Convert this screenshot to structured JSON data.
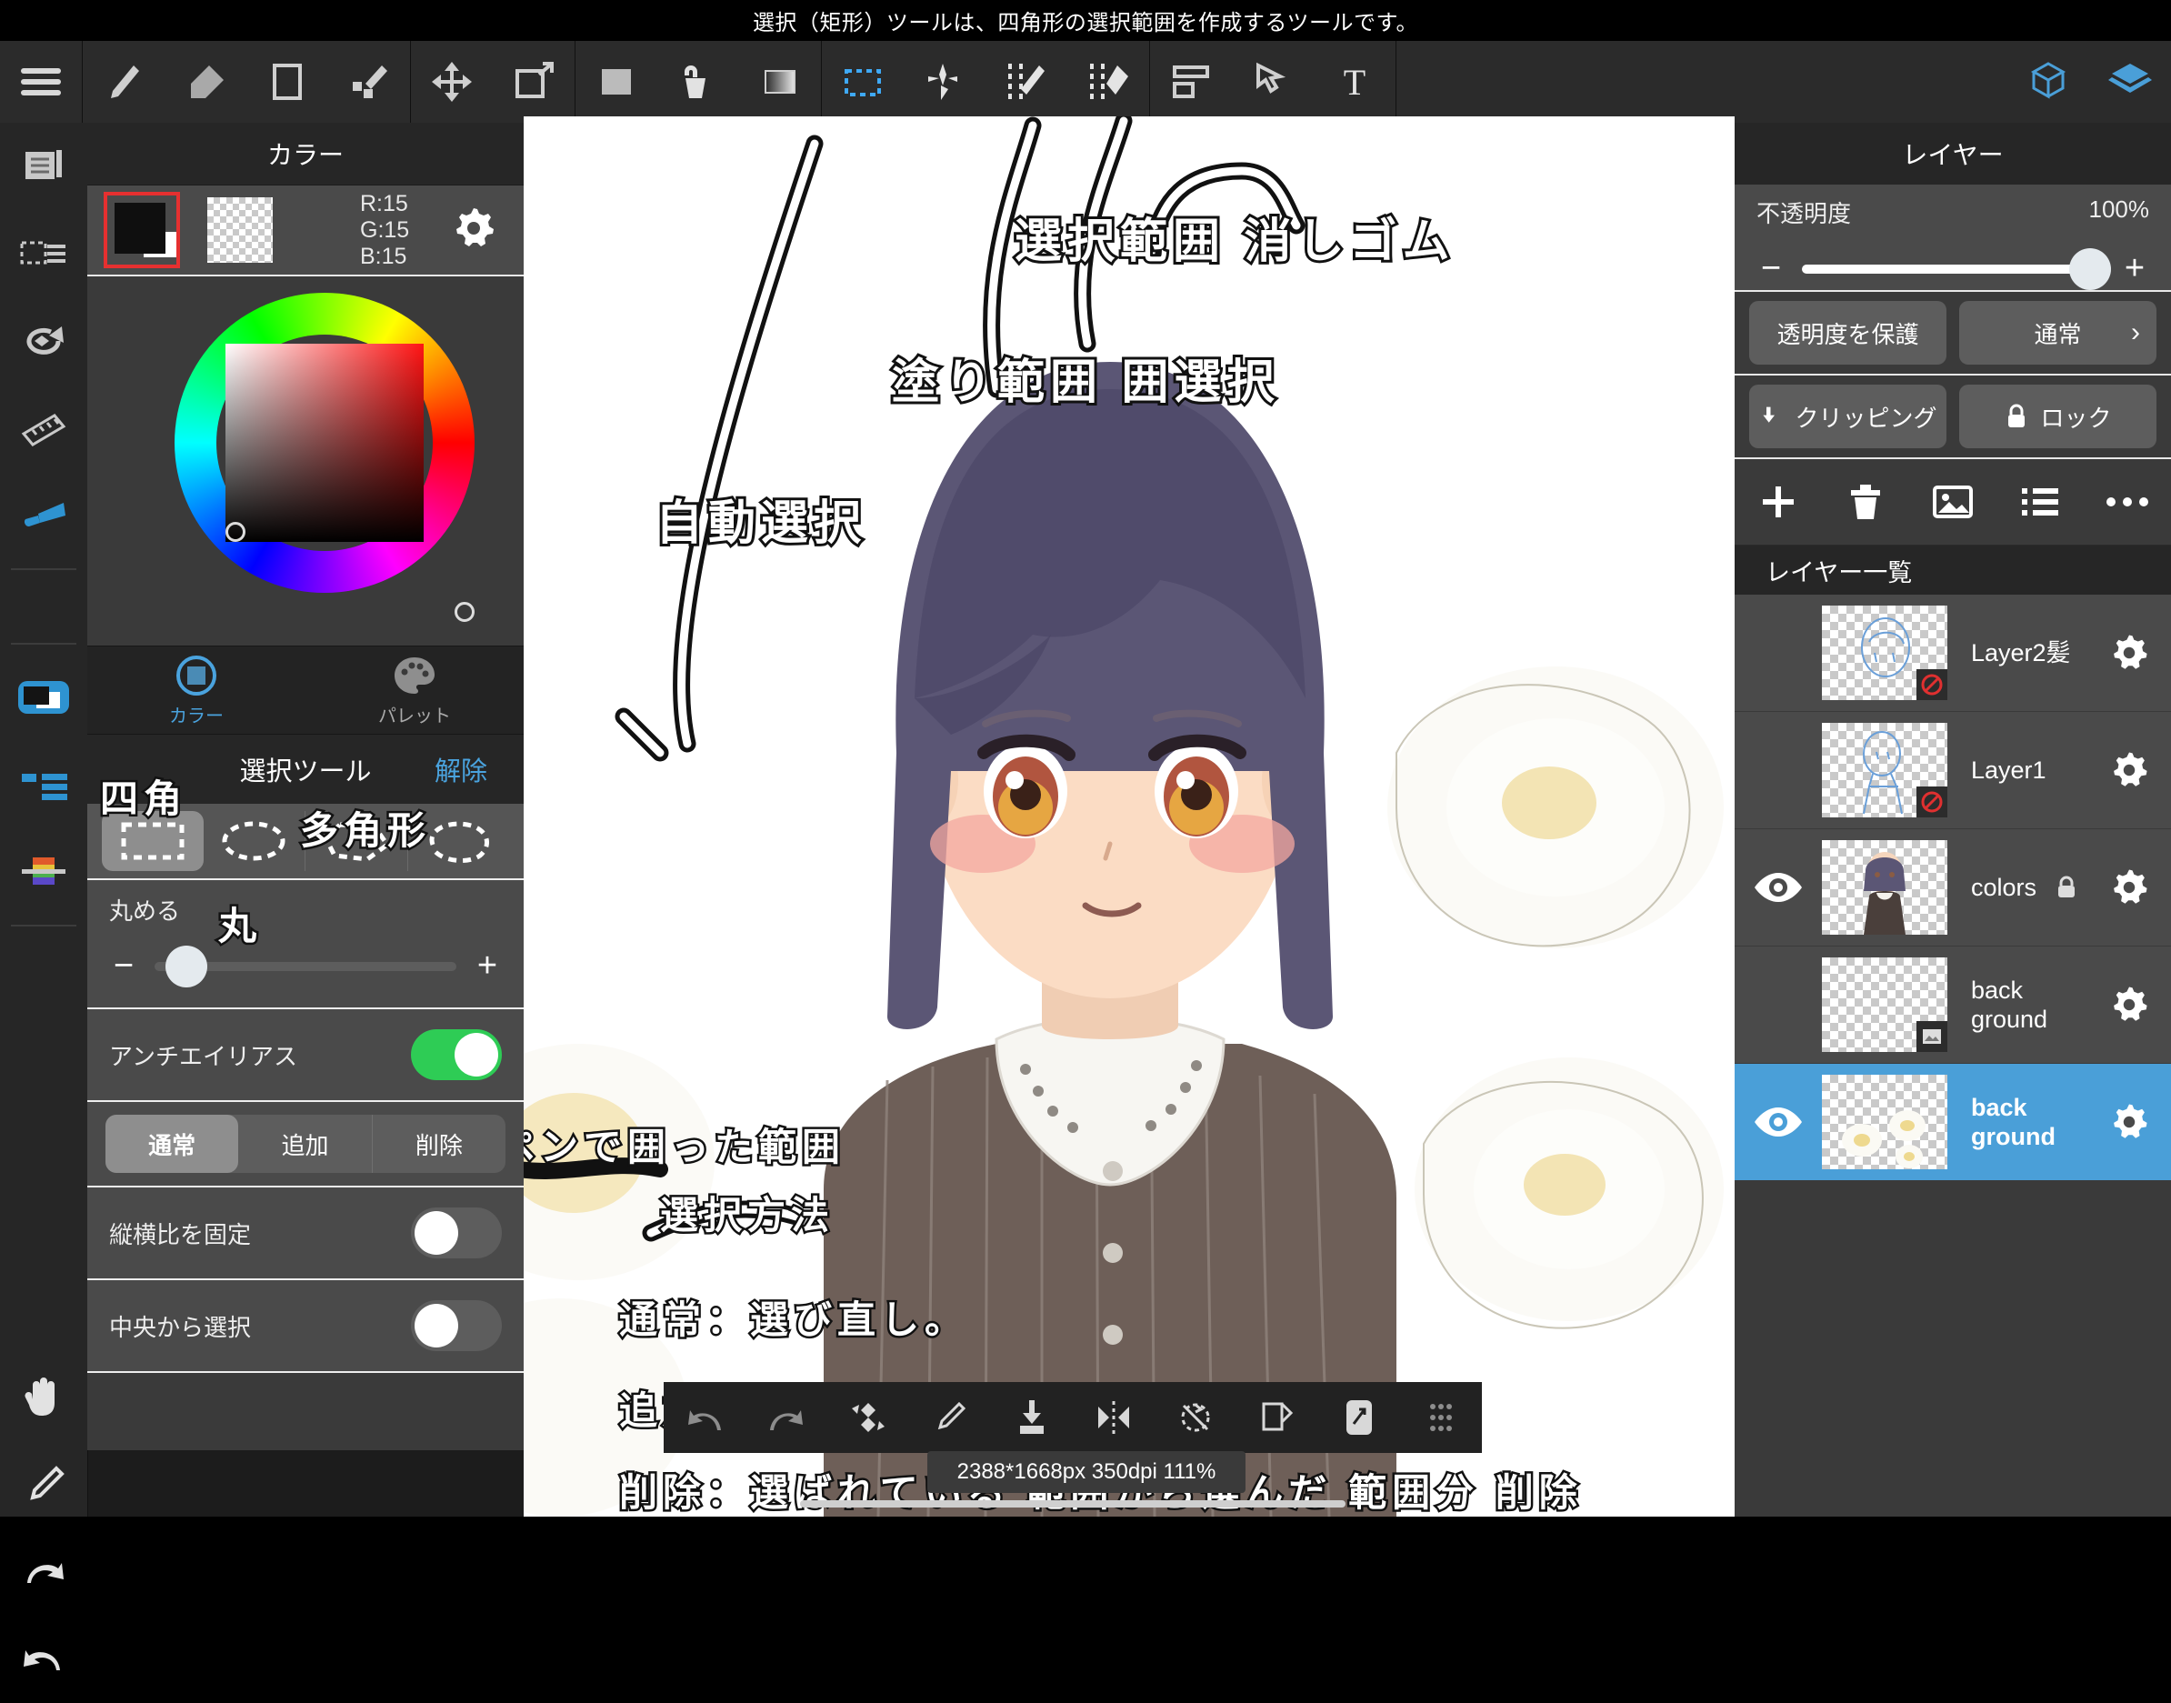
{
  "hint": {
    "text": "選択（矩形）ツールは、四角形の選択範囲を作成するツールです。"
  },
  "toolbar": {
    "menu_label": "menu",
    "tools": [
      {
        "name": "brush-tool",
        "label": "ブラシ"
      },
      {
        "name": "eraser-tool",
        "label": "消しゴム"
      },
      {
        "name": "shape-tool",
        "label": "図形"
      },
      {
        "name": "smudge-tool",
        "label": "ぼかし"
      },
      {
        "name": "move-tool",
        "label": "移動"
      },
      {
        "name": "transform-tool",
        "label": "変形"
      },
      {
        "name": "fill-tool",
        "label": "塗りつぶし"
      },
      {
        "name": "bucket-tool",
        "label": "バケツ"
      },
      {
        "name": "gradient-tool",
        "label": "グラデーション"
      },
      {
        "name": "select-rect-tool",
        "label": "選択（矩形）"
      },
      {
        "name": "auto-select-tool",
        "label": "自動選択"
      },
      {
        "name": "fill-area-select-tool",
        "label": "塗り範囲選択"
      },
      {
        "name": "select-eraser-tool",
        "label": "選択範囲消しゴム"
      },
      {
        "name": "canvas-tool",
        "label": "キャンバス"
      },
      {
        "name": "object-tool",
        "label": "オブジェクト"
      },
      {
        "name": "text-tool",
        "label": "テキスト"
      },
      {
        "name": "materials-tool",
        "label": "素材"
      },
      {
        "name": "layers-tool",
        "label": "レイヤー"
      }
    ]
  },
  "rail": {
    "items": [
      {
        "name": "pages-icon"
      },
      {
        "name": "selection-menu-icon"
      },
      {
        "name": "rotate-icon"
      },
      {
        "name": "ruler-icon"
      },
      {
        "name": "pen-pressure-icon"
      },
      {
        "name": "color-toggle-icon"
      },
      {
        "name": "list-icon"
      },
      {
        "name": "palette-bar-icon"
      },
      {
        "name": "hand-icon"
      },
      {
        "name": "eyedropper-icon"
      },
      {
        "name": "redo-icon"
      },
      {
        "name": "undo-icon"
      }
    ]
  },
  "color_panel": {
    "title": "カラー",
    "rgb": {
      "r": "R:15",
      "g": "G:15",
      "b": "B:15"
    },
    "foreground_hex": "#0f0f0f",
    "tabs": [
      {
        "label": "カラー",
        "active": true,
        "name": "tab-color"
      },
      {
        "label": "パレット",
        "active": false,
        "name": "tab-palette"
      }
    ]
  },
  "select_panel": {
    "title": "選択ツール",
    "clear_label": "解除",
    "shapes": [
      {
        "name": "shape-rect",
        "active": true
      },
      {
        "name": "shape-ellipse",
        "active": false
      },
      {
        "name": "shape-polygon",
        "active": false
      },
      {
        "name": "shape-lasso",
        "active": false
      }
    ],
    "round_label": "丸める",
    "round_value": 0,
    "antialias_label": "アンチエイリアス",
    "antialias_on": true,
    "modes": [
      {
        "label": "通常",
        "active": true,
        "name": "mode-normal"
      },
      {
        "label": "追加",
        "active": false,
        "name": "mode-add"
      },
      {
        "label": "削除",
        "active": false,
        "name": "mode-delete"
      }
    ],
    "fix_ratio_label": "縦横比を固定",
    "fix_ratio_on": false,
    "from_center_label": "中央から選択",
    "from_center_on": false
  },
  "layer_panel": {
    "title": "レイヤー",
    "opacity_label": "不透明度",
    "opacity_value": "100%",
    "opacity_pct": 100,
    "protect_label": "透明度を保護",
    "blend_label": "通常",
    "clipping_label": "クリッピング",
    "lock_label": "ロック",
    "actions": [
      {
        "name": "add-layer-button"
      },
      {
        "name": "delete-layer-button"
      },
      {
        "name": "import-image-button"
      },
      {
        "name": "layer-list-button"
      },
      {
        "name": "more-options-button"
      }
    ],
    "list_title": "レイヤー一覧",
    "layers": [
      {
        "name": "Layer2髪",
        "visible": false,
        "selected": false,
        "locked": false,
        "badge": "blocked",
        "thumb": "sketch-head"
      },
      {
        "name": "Layer1",
        "visible": false,
        "selected": false,
        "locked": false,
        "badge": "blocked",
        "thumb": "sketch-body"
      },
      {
        "name": "colors",
        "visible": true,
        "selected": false,
        "locked": true,
        "badge": "",
        "thumb": "character"
      },
      {
        "name": "back ground",
        "visible": false,
        "selected": false,
        "locked": false,
        "badge": "image",
        "thumb": "empty"
      },
      {
        "name": "back ground",
        "visible": true,
        "selected": true,
        "locked": false,
        "badge": "",
        "thumb": "flowers"
      }
    ]
  },
  "canvas": {
    "status": "2388*1668px 350dpi 111%",
    "annotations": [
      {
        "name": "annotation-select-eraser",
        "text": "選択範囲 消しゴム"
      },
      {
        "name": "annotation-fill-area-select",
        "text": "塗り範囲 囲選択"
      },
      {
        "name": "annotation-auto-select",
        "text": "自動選択"
      },
      {
        "name": "annotation-rect",
        "text": "四角"
      },
      {
        "name": "annotation-polygon",
        "text": "多角形"
      },
      {
        "name": "annotation-circle",
        "text": "丸"
      },
      {
        "name": "annotation-pen-area",
        "text": "ペンで囲った範囲"
      },
      {
        "name": "annotation-method-title",
        "text": "選択方法"
      },
      {
        "name": "annotation-method-normal",
        "text": "通常：選び直し。"
      },
      {
        "name": "annotation-method-add",
        "text": "追加：選ばれている 範囲に追加"
      },
      {
        "name": "annotation-method-delete",
        "text": "削除：選ばれている 範囲から選んだ 範囲分 削除"
      }
    ],
    "bottom_tools": [
      {
        "name": "undo-button"
      },
      {
        "name": "redo-button"
      },
      {
        "name": "flip-button"
      },
      {
        "name": "eyedropper-button"
      },
      {
        "name": "merge-down-button"
      },
      {
        "name": "mirror-button"
      },
      {
        "name": "rotate-reset-button"
      },
      {
        "name": "duplicate-button"
      },
      {
        "name": "export-button"
      },
      {
        "name": "grid-handle"
      }
    ]
  },
  "colors": {
    "accent": "#4a9fd8",
    "panel_bg": "#3a3a3a",
    "row_bg": "#4a4a4a",
    "toolbar_bg": "#2b2b2b",
    "toggle_on": "#2ecc55",
    "swatch_border": "#e63030"
  }
}
